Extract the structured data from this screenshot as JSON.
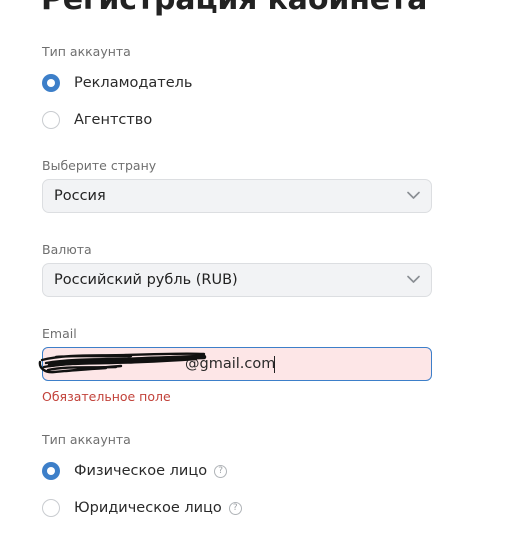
{
  "page": {
    "title": "Регистрация кабинета"
  },
  "account_type": {
    "label": "Тип аккаунта",
    "options": [
      {
        "label": "Рекламодатель",
        "checked": true
      },
      {
        "label": "Агентство",
        "checked": false
      }
    ]
  },
  "country": {
    "label": "Выберите страну",
    "value": "Россия",
    "icon": "chevron-down-icon"
  },
  "currency": {
    "label": "Валюта",
    "value": "Российский рубль (RUB)",
    "icon": "chevron-down-icon"
  },
  "email": {
    "label": "Email",
    "value": "@gmail.com",
    "error": "Обязательное поле",
    "redacted": true
  },
  "legal_type": {
    "label": "Тип аккаунта",
    "options": [
      {
        "label": "Физическое лицо",
        "checked": true,
        "help_icon": "question-circle-icon",
        "help_glyph": "?"
      },
      {
        "label": "Юридическое лицо",
        "checked": false,
        "help_icon": "question-circle-icon",
        "help_glyph": "?"
      }
    ]
  },
  "colors": {
    "accent": "#3d7fc9",
    "error": "#c2423a",
    "input_error_bg": "#fde6e7",
    "select_bg": "#f2f3f5"
  }
}
